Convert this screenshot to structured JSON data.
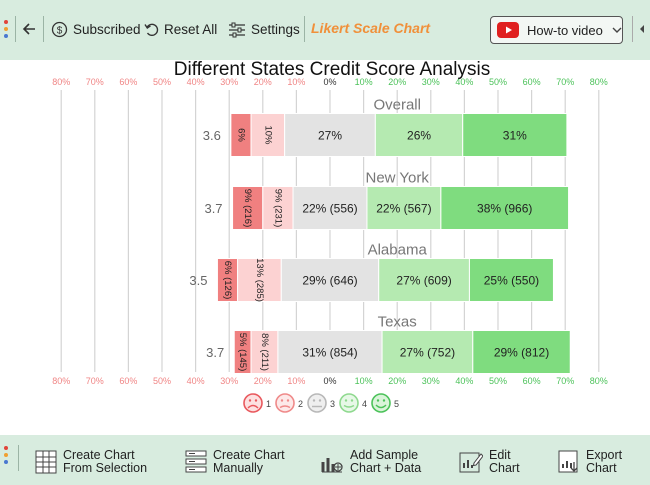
{
  "toolbar": {
    "subscribed_label": "Subscribed",
    "reset_label": "Reset All",
    "settings_label": "Settings",
    "app_name": "Likert Scale Chart",
    "howto_label": "How-to video"
  },
  "bottombar": {
    "create_selection": [
      "Create Chart",
      "From Selection"
    ],
    "create_manual": [
      "Create Chart",
      "Manually"
    ],
    "add_sample": [
      "Add Sample",
      "Chart + Data"
    ],
    "edit_chart": [
      "Edit",
      "Chart"
    ],
    "export_chart": [
      "Export",
      "Chart"
    ]
  },
  "colors": {
    "toolbar_bg": "#d8ecdf",
    "accent": "#f0903a",
    "neg_strong": "#f08080",
    "neg_light": "#fcd2d2",
    "neutral": "#e3e3e3",
    "pos_light": "#b5eab1",
    "pos_strong": "#7fdc7f"
  },
  "chart_data": {
    "type": "bar",
    "subtype": "diverging-stacked-likert",
    "title": "Different States Credit Score Analysis",
    "axis_ticks": [
      "80%",
      "70%",
      "60%",
      "50%",
      "40%",
      "30%",
      "20%",
      "10%",
      "0%",
      "10%",
      "20%",
      "30%",
      "40%",
      "50%",
      "60%",
      "70%",
      "80%"
    ],
    "xlim": [
      -80,
      80
    ],
    "grid": true,
    "legend": {
      "position": "bottom",
      "items": [
        "1",
        "2",
        "3",
        "4",
        "5"
      ]
    },
    "categories": [
      "Overall",
      "New York",
      "Alabama",
      "Texas"
    ],
    "averages": [
      "3.6",
      "3.7",
      "3.5",
      "3.7"
    ],
    "series": [
      {
        "name": "1",
        "values": [
          6,
          9,
          6,
          5
        ],
        "labels": [
          "6%",
          "9% (216)",
          "6% (126)",
          "5% (145)"
        ]
      },
      {
        "name": "2",
        "values": [
          10,
          9,
          13,
          8
        ],
        "labels": [
          "10%",
          "9% (231)",
          "13% (285)",
          "8% (211)"
        ]
      },
      {
        "name": "3",
        "values": [
          27,
          22,
          29,
          31
        ],
        "labels": [
          "27%",
          "22% (556)",
          "29% (646)",
          "31% (854)"
        ]
      },
      {
        "name": "4",
        "values": [
          26,
          22,
          27,
          27
        ],
        "labels": [
          "26%",
          "22% (567)",
          "27% (609)",
          "27% (752)"
        ]
      },
      {
        "name": "5",
        "values": [
          31,
          38,
          25,
          29
        ],
        "labels": [
          "31%",
          "38% (966)",
          "25% (550)",
          "29% (812)"
        ]
      }
    ]
  }
}
